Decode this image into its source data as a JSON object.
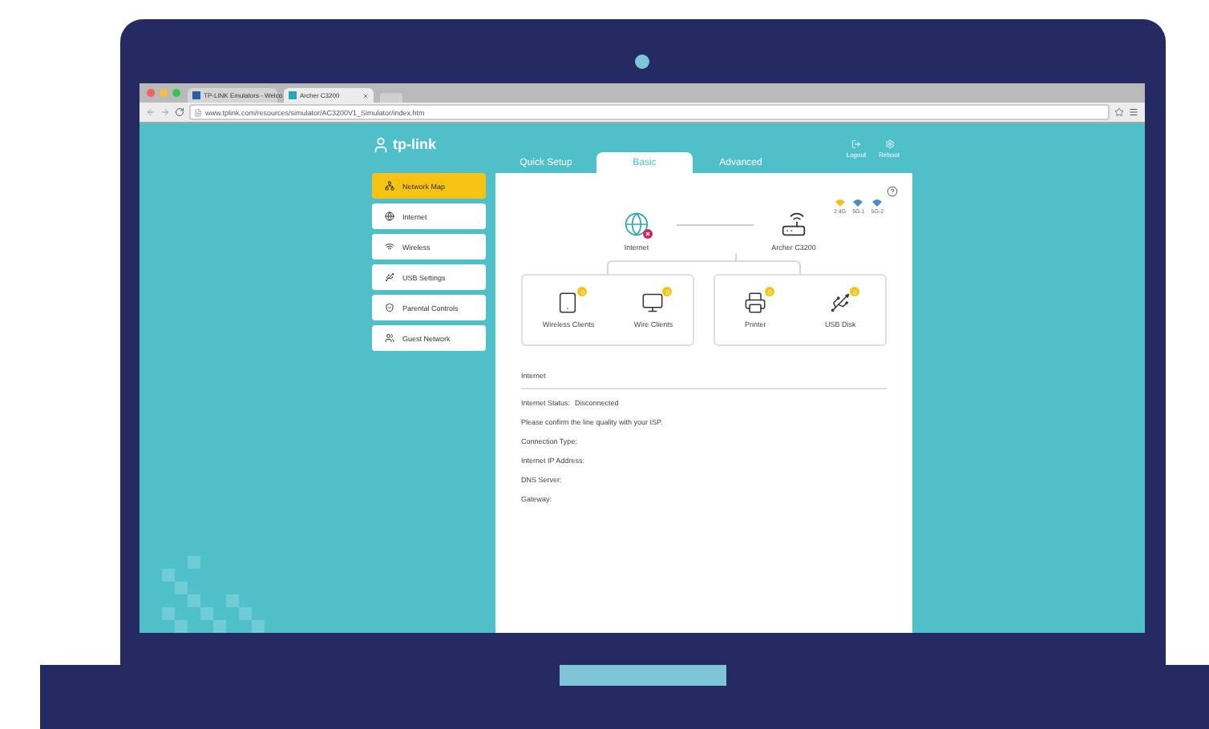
{
  "browser": {
    "tabs": [
      {
        "label": "TP-LINK Emulators - Welco",
        "selected": false
      },
      {
        "label": "Archer C3200",
        "selected": true
      }
    ],
    "url": "www.tplink.com/resources/simulator/AC3200V1_Simulator/index.htm"
  },
  "router_ui": {
    "logo": "tp-link",
    "tabs": [
      {
        "label": "Quick Setup",
        "selected": false
      },
      {
        "label": "Basic",
        "selected": true
      },
      {
        "label": "Advanced",
        "selected": false
      }
    ],
    "actions": [
      {
        "label": "Logout",
        "kind": "logout"
      },
      {
        "label": "Reboot",
        "kind": "reboot"
      }
    ],
    "sidebar": [
      {
        "label": "Network Map",
        "kind": "map",
        "selected": true
      },
      {
        "label": "Internet",
        "kind": "internet",
        "selected": false
      },
      {
        "label": "Wireless",
        "kind": "wireless",
        "selected": false
      },
      {
        "label": "USB Settings",
        "kind": "usb",
        "selected": false
      },
      {
        "label": "Parental Controls",
        "kind": "parental",
        "selected": false
      },
      {
        "label": "Guest Network",
        "kind": "guest",
        "selected": false
      }
    ],
    "network_map": {
      "internet": {
        "label": "Internet",
        "disconnected": true
      },
      "router": {
        "label": "Archer C3200"
      },
      "bands": [
        {
          "label": "2.4G",
          "color": "#f2c21b"
        },
        {
          "label": "5G-1",
          "color": "#4a90c8"
        },
        {
          "label": "5G-2",
          "color": "#4a90c8"
        }
      ],
      "groups": [
        [
          {
            "label": "Wireless Clients",
            "kind": "wireless",
            "count": "0"
          },
          {
            "label": "Wire Clients",
            "kind": "wired",
            "count": "0"
          }
        ],
        [
          {
            "label": "Printer",
            "kind": "printer",
            "count": "0"
          },
          {
            "label": "USB Disk",
            "kind": "usb",
            "count": "0"
          }
        ]
      ]
    },
    "internet_section": {
      "title": "Internet",
      "rows": [
        {
          "label": "Internet Status:",
          "value": "Disconnected"
        },
        {
          "label": "Please confirm the line quality with your ISP."
        },
        {
          "label": "Connection Type:"
        },
        {
          "label": "Internet IP Address:"
        },
        {
          "label": "DNS Server:"
        },
        {
          "label": "Gateway:"
        }
      ]
    }
  }
}
